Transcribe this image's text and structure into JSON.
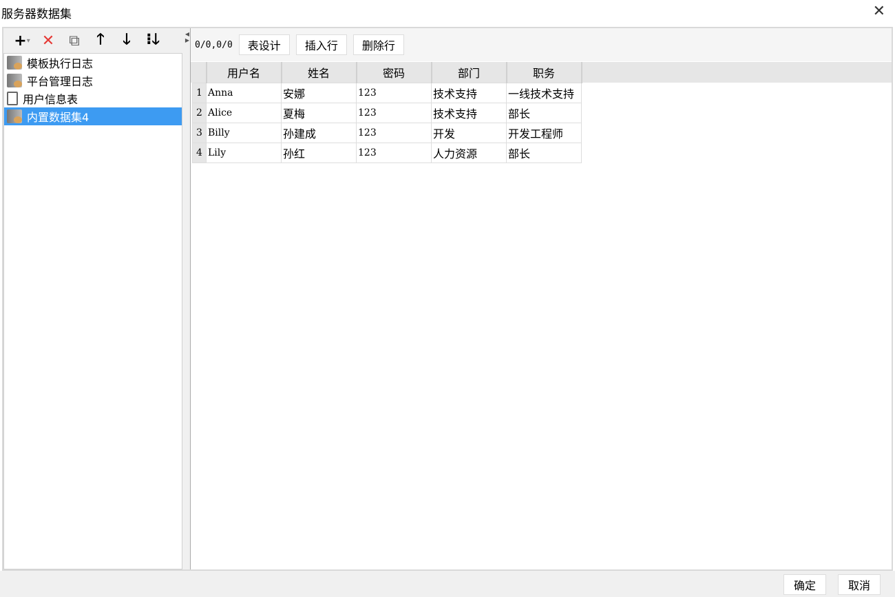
{
  "window": {
    "title": "服务器数据集",
    "close": "✕"
  },
  "left_toolbar": {
    "add": "+",
    "add_dd": "▾",
    "delete": "✕",
    "copy": "⧉",
    "up": "🡑",
    "down": "🡓",
    "sort": "⁝🡓"
  },
  "tree": [
    {
      "label": "模板执行日志"
    },
    {
      "label": "平台管理日志"
    },
    {
      "label": "用户信息表"
    },
    {
      "label": "内置数据集4"
    }
  ],
  "right_toolbar": {
    "position": "0/0,0/0",
    "design": "表设计",
    "insert": "插入行",
    "delete": "删除行"
  },
  "table": {
    "columns": [
      "用户名",
      "姓名",
      "密码",
      "部门",
      "职务"
    ],
    "rows": [
      [
        "Anna",
        "安娜",
        "123",
        "技术支持",
        "一线技术支持"
      ],
      [
        "Alice",
        "夏梅",
        "123",
        "技术支持",
        "部长"
      ],
      [
        "Billy",
        "孙建成",
        "123",
        "开发",
        "开发工程师"
      ],
      [
        "Lily",
        "孙红",
        "123",
        "人力资源",
        "部长"
      ]
    ]
  },
  "footer": {
    "ok": "确定",
    "cancel": "取消"
  }
}
